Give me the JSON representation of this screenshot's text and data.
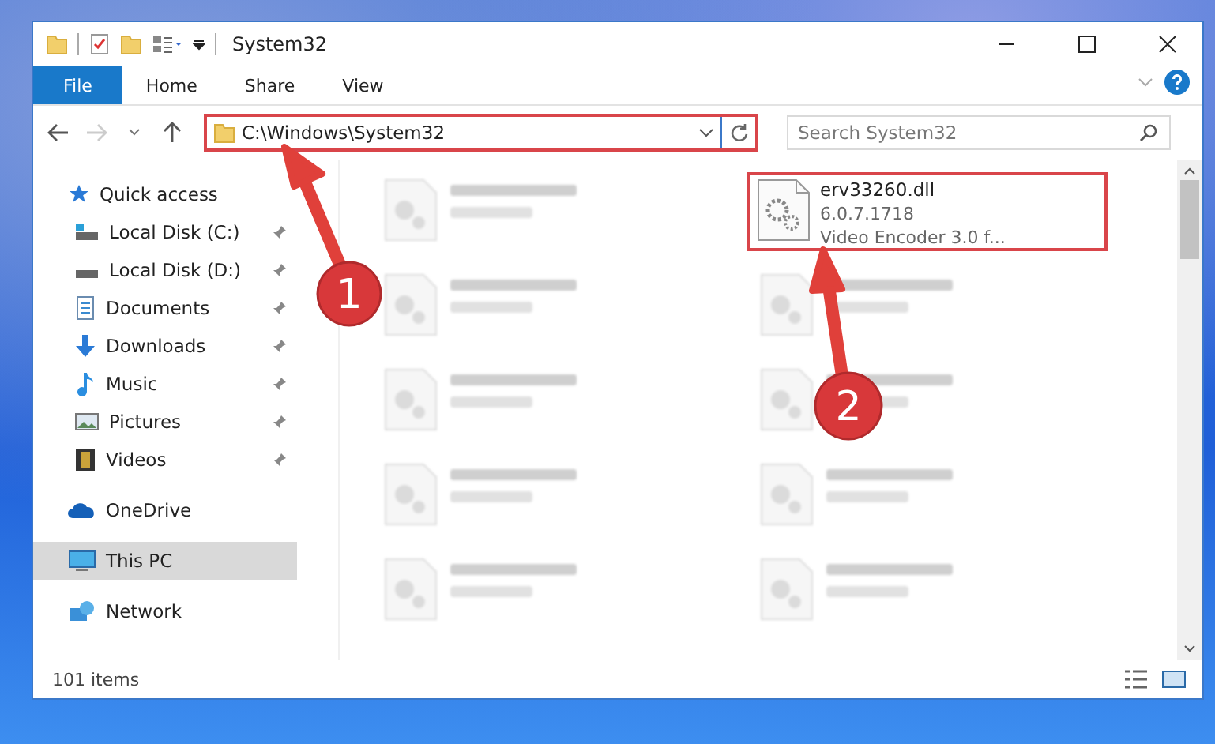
{
  "window": {
    "title": "System32"
  },
  "ribbon_tabs": [
    {
      "label": "File",
      "kind": "menu"
    },
    {
      "label": "Home",
      "kind": "tab"
    },
    {
      "label": "Share",
      "kind": "tab"
    },
    {
      "label": "View",
      "kind": "tab"
    }
  ],
  "address": {
    "path": "C:\\Windows\\System32",
    "highlighted": true
  },
  "search": {
    "placeholder": "Search System32"
  },
  "sidebar": {
    "items": [
      {
        "label": "Quick access",
        "selected": false,
        "children": [
          {
            "label": "Local Disk (C:)",
            "pinned": true,
            "selected": false
          },
          {
            "label": "Local Disk (D:)",
            "pinned": true,
            "selected": false
          },
          {
            "label": "Documents",
            "pinned": true,
            "selected": false
          },
          {
            "label": "Downloads",
            "pinned": true,
            "selected": false
          },
          {
            "label": "Music",
            "pinned": true,
            "selected": false
          },
          {
            "label": "Pictures",
            "pinned": true,
            "selected": false
          },
          {
            "label": "Videos",
            "pinned": true,
            "selected": false
          }
        ]
      },
      {
        "label": "OneDrive",
        "selected": false
      },
      {
        "label": "This PC",
        "selected": true
      },
      {
        "label": "Network",
        "selected": false
      }
    ]
  },
  "files": [
    {
      "kind": "blurred",
      "highlighted": false
    },
    {
      "kind": "file",
      "lines": [
        "erv33260.dll",
        "6.0.7.1718",
        "Video Encoder 3.0 f..."
      ],
      "highlighted": true
    },
    {
      "kind": "blurred",
      "highlighted": false
    },
    {
      "kind": "blurred",
      "highlighted": false
    },
    {
      "kind": "blurred",
      "highlighted": false
    },
    {
      "kind": "blurred",
      "highlighted": false
    },
    {
      "kind": "blurred",
      "highlighted": false
    },
    {
      "kind": "blurred",
      "highlighted": false
    },
    {
      "kind": "blurred",
      "highlighted": false
    },
    {
      "kind": "blurred",
      "highlighted": false
    }
  ],
  "status_bar": {
    "item_count": "101 items"
  },
  "annotations": [
    {
      "label": "1"
    },
    {
      "label": "2"
    }
  ]
}
